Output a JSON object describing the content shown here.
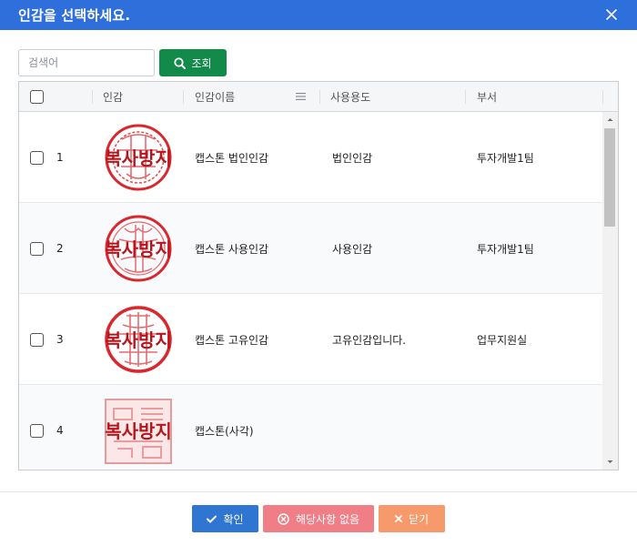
{
  "dialog": {
    "title": "인감을 선택하세요.",
    "close_icon": "close-icon"
  },
  "search": {
    "placeholder": "검색어",
    "value": "",
    "button_label": "조회",
    "button_icon": "search-icon"
  },
  "grid": {
    "columns": {
      "seal": "인감",
      "name": "인감이름",
      "usage": "사용용도",
      "dept": "부서"
    },
    "rows": [
      {
        "no": "1",
        "seal_text": "복사방지",
        "name": "캡스톤 법인인감",
        "usage": "법인인감",
        "dept": "투자개발1팀"
      },
      {
        "no": "2",
        "seal_text": "복사방지",
        "name": "캡스톤 사용인감",
        "usage": "사용인감",
        "dept": "투자개발1팀"
      },
      {
        "no": "3",
        "seal_text": "복사방지",
        "name": "캡스톤 고유인감",
        "usage": "고유인감입니다.",
        "dept": "업무지원실"
      },
      {
        "no": "4",
        "seal_text": "복사방지",
        "name": "캡스톤(사각)",
        "usage": "",
        "dept": ""
      }
    ]
  },
  "footer": {
    "confirm_label": "확인",
    "none_label": "해당사항 없음",
    "close_label": "닫기"
  },
  "colors": {
    "title_bar": "#2f6fdb",
    "search_button": "#128a4a",
    "confirm_button": "#2f76d2",
    "none_button": "#ef7e86",
    "close_button": "#f69a6b",
    "seal_red": "#d9272e"
  }
}
